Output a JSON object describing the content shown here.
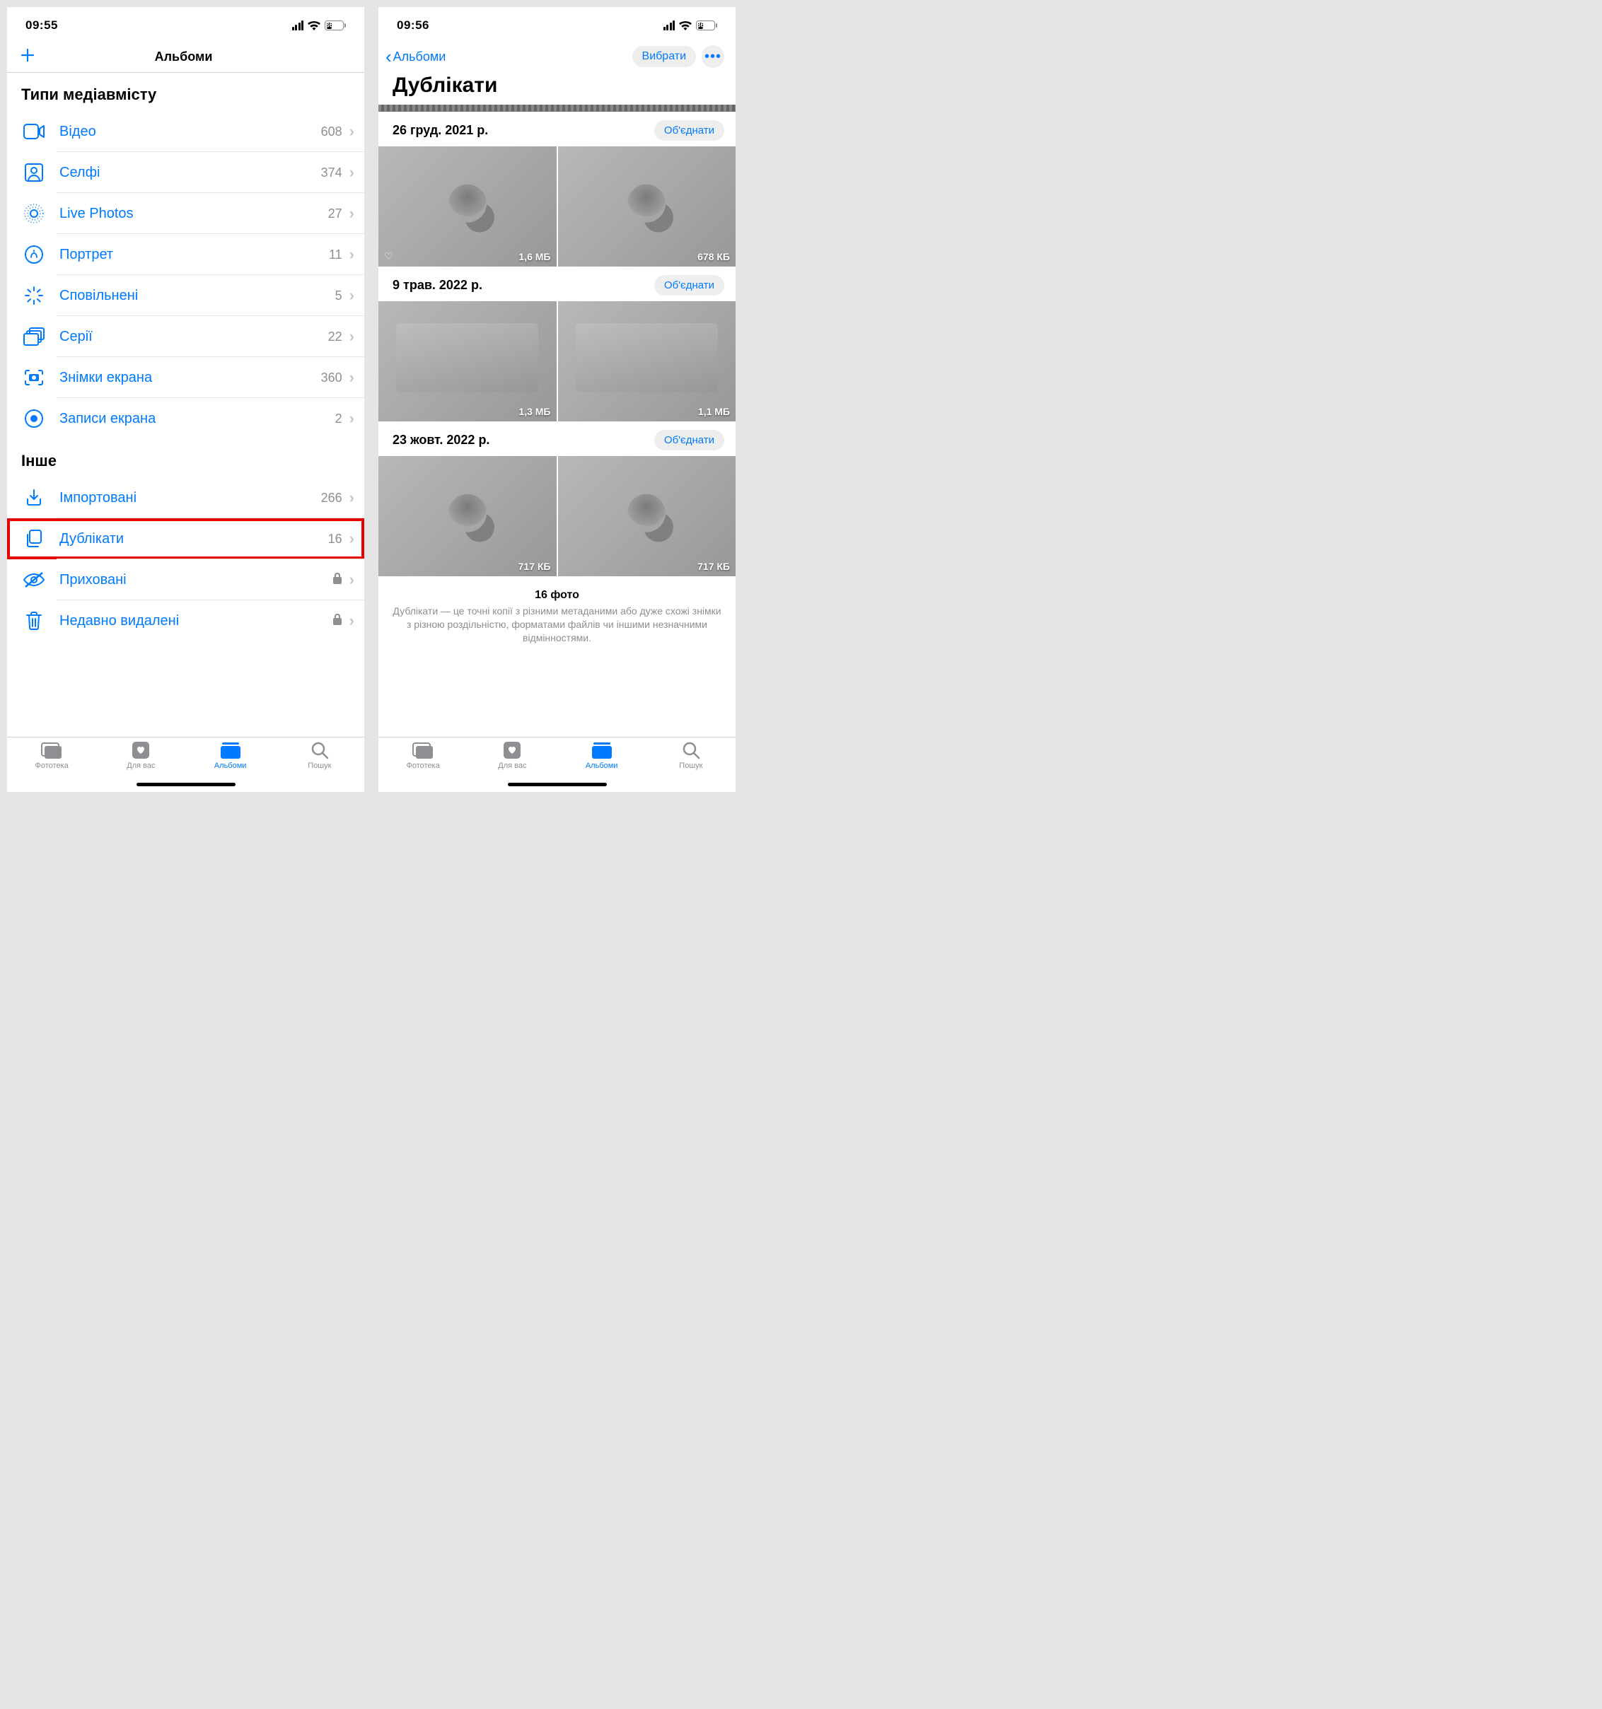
{
  "left": {
    "status": {
      "time": "09:55",
      "battery": "36"
    },
    "nav_title": "Альбоми",
    "sections": {
      "media_types": {
        "title": "Типи медіавмісту",
        "rows": [
          {
            "label": "Відео",
            "count": "608"
          },
          {
            "label": "Селфі",
            "count": "374"
          },
          {
            "label": "Live Photos",
            "count": "27"
          },
          {
            "label": "Портрет",
            "count": "11"
          },
          {
            "label": "Сповільнені",
            "count": "5"
          },
          {
            "label": "Серії",
            "count": "22"
          },
          {
            "label": "Знімки екрана",
            "count": "360"
          },
          {
            "label": "Записи екрана",
            "count": "2"
          }
        ]
      },
      "other": {
        "title": "Інше",
        "rows": [
          {
            "label": "Імпортовані",
            "count": "266"
          },
          {
            "label": "Дублікати",
            "count": "16"
          },
          {
            "label": "Приховані"
          },
          {
            "label": "Недавно видалені"
          }
        ]
      }
    }
  },
  "right": {
    "status": {
      "time": "09:56",
      "battery": "36"
    },
    "back_label": "Альбоми",
    "select_label": "Вибрати",
    "title": "Дублікати",
    "merge_label": "Об'єднати",
    "groups": [
      {
        "date": "26 груд. 2021 р.",
        "thumbs": [
          {
            "size": "1,6 МБ",
            "heart": true
          },
          {
            "size": "678 КБ"
          }
        ]
      },
      {
        "date": "9 трав. 2022 р.",
        "thumbs": [
          {
            "size": "1,3 МБ"
          },
          {
            "size": "1,1 МБ"
          }
        ]
      },
      {
        "date": "23 жовт. 2022 р.",
        "thumbs": [
          {
            "size": "717 КБ"
          },
          {
            "size": "717 КБ"
          }
        ]
      }
    ],
    "footer_count": "16 фото",
    "footer_note": "Дублікати — це точні копії з різними метаданими або дуже схожі знімки з різною роздільністю, форматами файлів чи іншими незначними відмінностями."
  },
  "tabs": [
    {
      "label": "Фототека"
    },
    {
      "label": "Для вас"
    },
    {
      "label": "Альбоми"
    },
    {
      "label": "Пошук"
    }
  ]
}
